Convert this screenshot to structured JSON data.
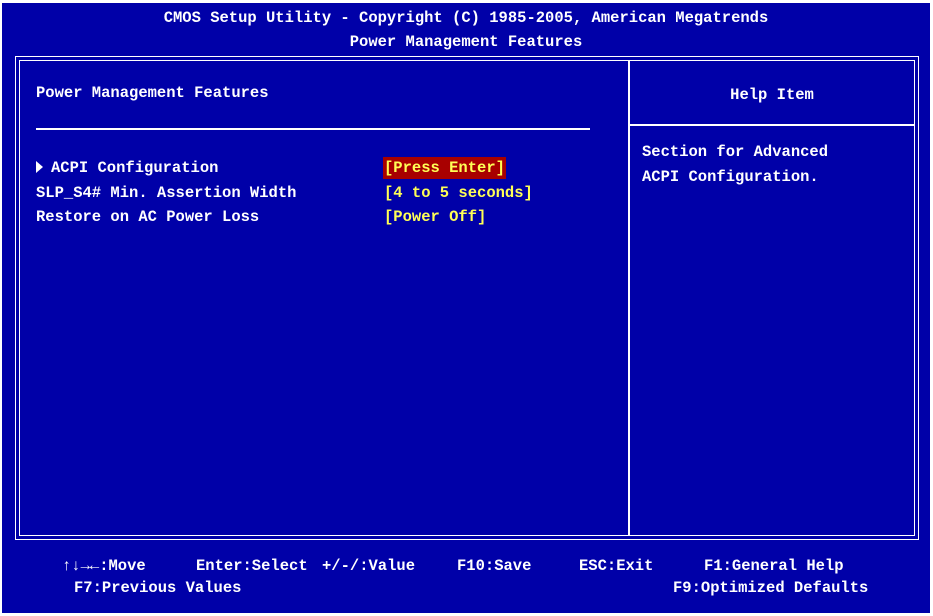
{
  "header": {
    "title": "CMOS Setup Utility - Copyright (C) 1985-2005, American Megatrends",
    "subtitle": "Power Management Features"
  },
  "main": {
    "section_title": "Power Management Features",
    "items": [
      {
        "label": "ACPI Configuration",
        "value": "[Press Enter]",
        "submenu": true,
        "selected": true
      },
      {
        "label": "SLP_S4# Min. Assertion Width",
        "value": "[4 to 5 seconds]",
        "submenu": false,
        "selected": false
      },
      {
        "label": "Restore on AC Power Loss",
        "value": "[Power Off]",
        "submenu": false,
        "selected": false
      }
    ]
  },
  "help": {
    "title": "Help Item",
    "text": "Section for Advanced\nACPI Configuration."
  },
  "footer": {
    "move": "↑↓→←:Move",
    "enter": "Enter:Select",
    "value": "+/-/:Value",
    "save": "F10:Save",
    "exit": "ESC:Exit",
    "help": "F1:General Help",
    "previous": "F7:Previous Values",
    "optimized": "F9:Optimized Defaults"
  },
  "colors": {
    "background": "#0000a8",
    "text": "#ffffff",
    "value_text": "#ffff55",
    "selection_highlight": "#a80000",
    "outer_frame": "#ffffff"
  },
  "icons": {
    "submenu": "submenu-arrow-icon"
  }
}
